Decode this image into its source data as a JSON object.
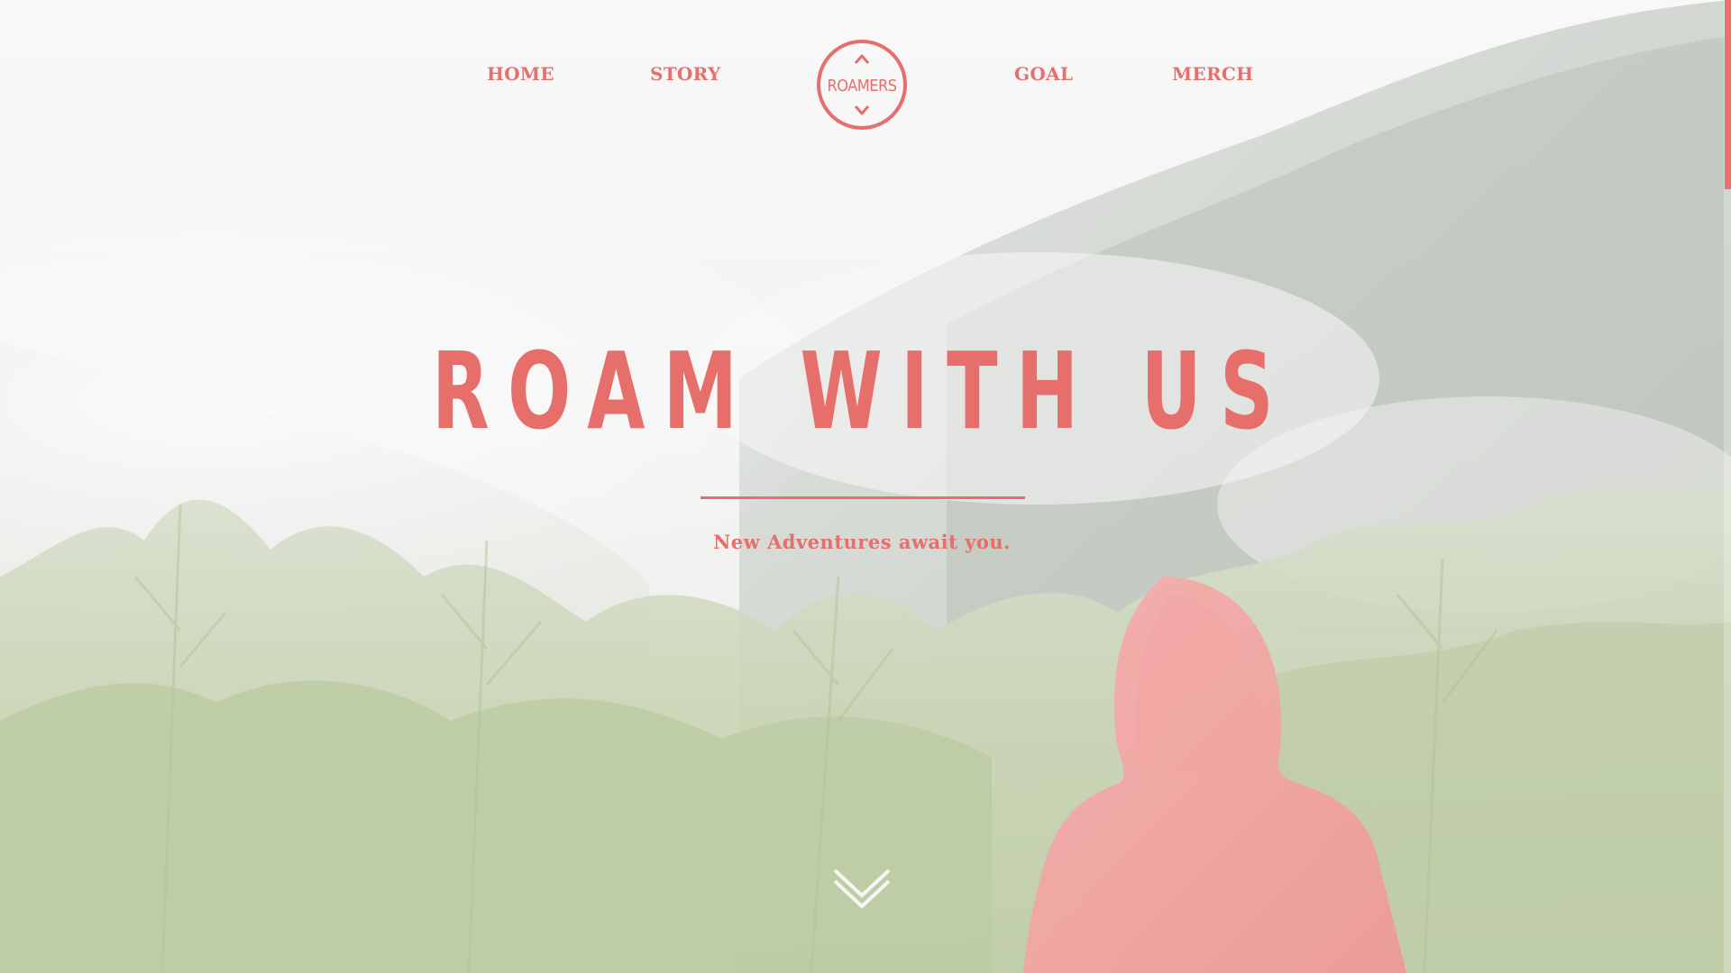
{
  "nav": {
    "items": [
      {
        "label": "HOME"
      },
      {
        "label": "STORY"
      },
      {
        "label": "GOAL"
      },
      {
        "label": "MERCH"
      }
    ],
    "logo_text": "ROAMERS"
  },
  "hero": {
    "title": "ROAM WITH US",
    "subtitle": "New Adventures await you."
  },
  "scroll": {
    "position": 0
  },
  "colors": {
    "accent": "#e66e6b",
    "hoodie": "#ef9c98",
    "forest": "#b9cc9f",
    "fog": "#f4f3f3"
  },
  "icons": {
    "logo": "roamers-compass-logo",
    "scroll": "double-chevron-down-icon"
  }
}
